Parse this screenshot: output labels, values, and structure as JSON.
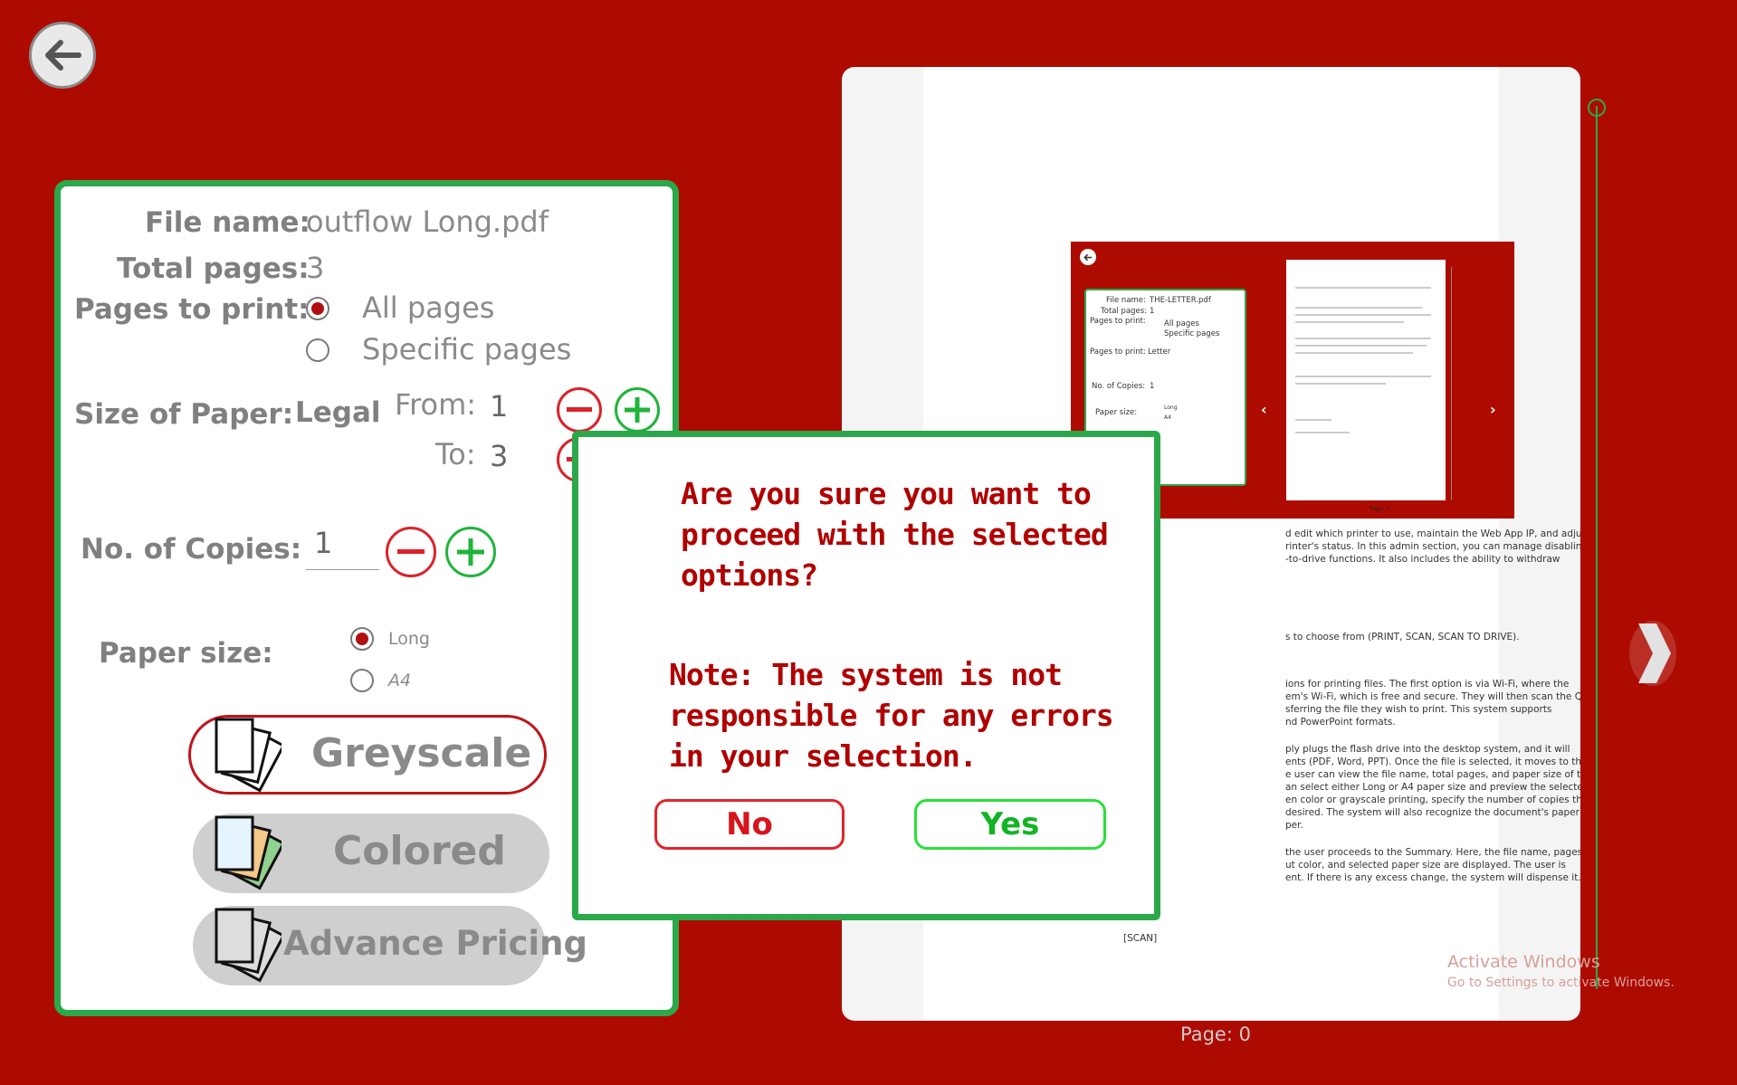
{
  "settings": {
    "file_name_label": "File name:",
    "file_name": "outflow Long.pdf",
    "total_pages_label": "Total pages:",
    "total_pages": "3",
    "pages_to_print_label": "Pages to print:",
    "all_pages": "All pages",
    "specific_pages": "Specific pages",
    "size_label": "Size of Paper:",
    "size_value": "Legal",
    "from_label": "From:",
    "from_value": "1",
    "to_label": "To:",
    "to_value": "3",
    "copies_label": "No. of Copies:",
    "copies_value": "1",
    "paper_size_label": "Paper size:",
    "paper_long": "Long",
    "paper_a4": "A4",
    "greyscale": "Greyscale",
    "colored": "Colored",
    "advance_pricing": "Advance Pricing"
  },
  "preview": {
    "thumb": {
      "file_name_label": "File name:",
      "file_name": "THE-LETTER.pdf",
      "total_pages_label": "Total pages:",
      "total_pages": "1",
      "pages_to_print_label": "Pages to print:",
      "all_pages": "All pages",
      "specific_pages": "Specific pages",
      "size_label": "Pages to print:",
      "size_value": "Letter",
      "copies_label": "No. of Copies:",
      "copies_value": "1",
      "paper_size_label": "Paper size:",
      "paper_long": "Long",
      "paper_a4": "A4",
      "page_label": "Page: 1"
    },
    "doc_lines": [
      "d edit which printer to use, maintain the Web App IP, and adjust",
      "rinter's status. In this admin section, you can manage disabling",
      "-to-drive functions. It also includes the ability to withdraw",
      "s to choose from (PRINT, SCAN, SCAN TO DRIVE).",
      "ions for printing files. The first option is via Wi-Fi, where the",
      "em's Wi-Fi, which is free and secure. They will then scan the QR",
      "sferring the file they wish to print. This system supports",
      "nd PowerPoint formats.",
      "ply plugs the flash drive into the desktop system, and it will",
      "ents (PDF, Word, PPT). Once the file is selected, it moves to the",
      "e user can view the file name, total pages, and paper size of the",
      "an select either Long or A4 paper size and preview the selected",
      "en color or grayscale printing, specify the number of copies they",
      " desired. The system will also recognize the document's paper",
      "per.",
      " the user proceeds to the Summary. Here, the file name, pages",
      "ut color, and selected paper size are displayed. The user is",
      "ent. If there is any excess change, the system will dispense it."
    ],
    "scan_label": "[SCAN]",
    "page_label": "Page: 0"
  },
  "dialog": {
    "question": [
      "Are you sure you want to",
      "proceed with the selected",
      "options?"
    ],
    "note": [
      "Note: The system is not",
      "responsible for any errors",
      "in your selection."
    ],
    "no": "No",
    "yes": "Yes"
  },
  "watermark": {
    "title": "Activate Windows",
    "subtitle": "Go to Settings to activate Windows."
  }
}
